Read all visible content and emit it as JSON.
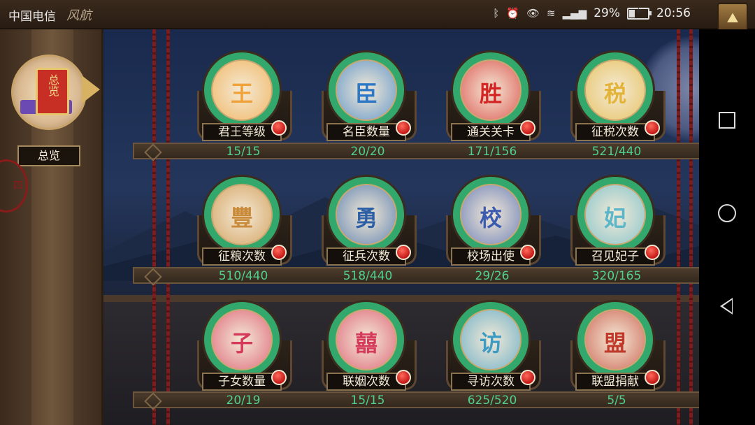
{
  "statusbar": {
    "carrier": "中国电信",
    "app_mark": "风航",
    "battery": "29%",
    "battery_level": 0.29,
    "time": "20:56",
    "icons": [
      "bluetooth-icon",
      "alarm-icon",
      "eye-icon",
      "wifi-icon",
      "signal-4g-icon",
      "battery-icon"
    ]
  },
  "sidebar": {
    "overview_label": "总览",
    "scroll_text": "总览",
    "seal_text": "四"
  },
  "corner_button_glyph": "⛰",
  "stats": [
    {
      "label": "君王等级",
      "value": "15/15",
      "glyph": "王",
      "color": "#f0a33a",
      "progress": 1.0
    },
    {
      "label": "名臣数量",
      "value": "20/20",
      "glyph": "臣",
      "color": "#2d78c6",
      "progress": 1.0
    },
    {
      "label": "通关关卡",
      "value": "171/156",
      "glyph": "胜",
      "color": "#d42525",
      "progress": 1.0
    },
    {
      "label": "征税次数",
      "value": "521/440",
      "glyph": "税",
      "color": "#e2b53a",
      "progress": 1.0
    },
    {
      "label": "征粮次数",
      "value": "510/440",
      "glyph": "豐",
      "color": "#c98a3a",
      "progress": 1.0
    },
    {
      "label": "征兵次数",
      "value": "518/440",
      "glyph": "勇",
      "color": "#2d5fa6",
      "progress": 1.0
    },
    {
      "label": "校场出使",
      "value": "29/26",
      "glyph": "校",
      "color": "#3b5bb0",
      "progress": 1.0
    },
    {
      "label": "召见妃子",
      "value": "320/165",
      "glyph": "妃",
      "color": "#5cb6c9",
      "progress": 1.0
    },
    {
      "label": "子女数量",
      "value": "20/19",
      "glyph": "子",
      "color": "#d63a5a",
      "progress": 1.0
    },
    {
      "label": "联姻次数",
      "value": "15/15",
      "glyph": "囍",
      "color": "#d63a5a",
      "progress": 1.0
    },
    {
      "label": "寻访次数",
      "value": "625/520",
      "glyph": "访",
      "color": "#3e9bc4",
      "progress": 1.0
    },
    {
      "label": "联盟捐献",
      "value": "5/5",
      "glyph": "盟",
      "color": "#c0392b",
      "progress": 1.0
    }
  ]
}
